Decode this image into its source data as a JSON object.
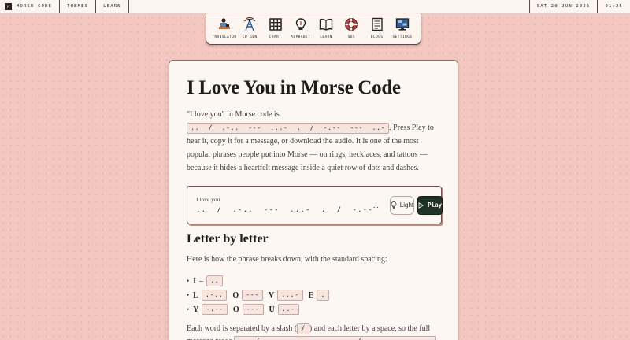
{
  "topbar": {
    "logo_mark": "M",
    "brand": "Morse code",
    "links": [
      "Themes",
      "Learn"
    ],
    "date": "Sat 20 Jun 2026",
    "time": "01:25"
  },
  "nav": [
    {
      "label": "Translator",
      "icon": "telegraph-operator-icon"
    },
    {
      "label": "CW Gen",
      "icon": "radio-tower-icon"
    },
    {
      "label": "Chart",
      "icon": "grid-chart-icon"
    },
    {
      "label": "Alphabet",
      "icon": "lightbulb-icon"
    },
    {
      "label": "Learn",
      "icon": "open-book-icon"
    },
    {
      "label": "SOS",
      "icon": "lifebuoy-icon"
    },
    {
      "label": "Blogs",
      "icon": "document-icon"
    },
    {
      "label": "Settings",
      "icon": "monitor-icon"
    }
  ],
  "article": {
    "title": "I Love You in Morse Code",
    "intro_before": "\"I love you\" in Morse code is ",
    "intro_code": "..  /  .-..  ---  ...-  .  /  -.--  ---  ..-",
    "intro_after": ". Press Play to hear it, copy it for a message, or download the audio. It is one of the most popular phrases people put into Morse — on rings, necklaces, and tattoos — because it hides a heartfelt message inside a quiet row of dots and dashes.",
    "player": {
      "label": "I love you",
      "code": "..  /  .-..  ---  ...-  .  /  -.--",
      "ellipsis": "...",
      "light_label": "Light",
      "play_label": "Play"
    },
    "section_title": "Letter by letter",
    "section_intro": "Here is how the phrase breaks down, with the standard spacing:",
    "rows": [
      [
        {
          "letter": "I",
          "dash": "–",
          "code": ".."
        }
      ],
      [
        {
          "letter": "L",
          "code": ".-.."
        },
        {
          "letter": "O",
          "code": "---"
        },
        {
          "letter": "V",
          "code": "...-"
        },
        {
          "letter": "E",
          "code": "."
        }
      ],
      [
        {
          "letter": "Y",
          "code": "-.--"
        },
        {
          "letter": "O",
          "code": "---"
        },
        {
          "letter": "U",
          "code": "..-"
        }
      ]
    ],
    "closing_before": "Each word is separated by a slash (",
    "closing_slash": "/",
    "closing_middle": ") and each letter by a space, so the full message reads ",
    "closing_code": "..  /  .-..  ---  ...-  .  /  -.--  ---  ..-",
    "closing_after": "."
  }
}
